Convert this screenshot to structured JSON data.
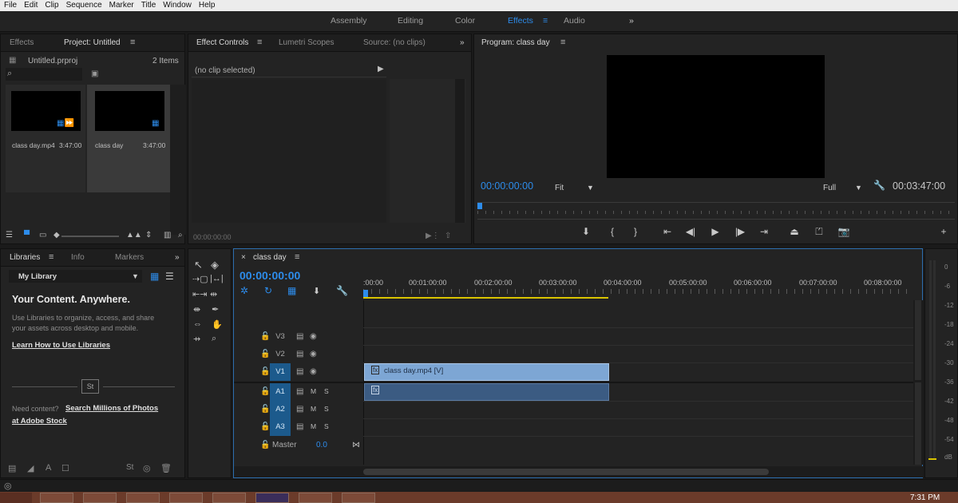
{
  "menu": [
    "File",
    "Edit",
    "Clip",
    "Sequence",
    "Marker",
    "Title",
    "Window",
    "Help"
  ],
  "workspaces": {
    "items": [
      "Assembly",
      "Editing",
      "Color",
      "Effects",
      "Audio"
    ],
    "active": "Effects",
    "more": "»"
  },
  "project_panel": {
    "tabs": [
      "Effects",
      "Project: Untitled"
    ],
    "file_name": "Untitled.prproj",
    "item_count": "2 Items",
    "items": [
      {
        "name": "class day.mp4",
        "duration": "3:47:00"
      },
      {
        "name": "class day",
        "duration": "3:47:00"
      }
    ]
  },
  "effect_controls": {
    "tabs": [
      "Effect Controls",
      "Lumetri Scopes",
      "Source: (no clips)"
    ],
    "no_clip": "(no clip selected)",
    "timecode": "00:00:00:00",
    "more": "»"
  },
  "program_monitor": {
    "title": "Program: class day",
    "timecode": "00:00:00:00",
    "fit": "Fit",
    "quality": "Full",
    "duration": "00:03:47:00"
  },
  "libraries_panel": {
    "tabs": [
      "Libraries",
      "Info",
      "Markers"
    ],
    "library": "My Library",
    "heading": "Your Content. Anywhere.",
    "desc_line1": "Use Libraries to organize, access, and share",
    "desc_line2": "your assets across desktop and mobile.",
    "learn_link": "Learn How to Use Libraries",
    "stock_badge": "St",
    "need_content": "Need content?",
    "search_link_1": "Search Millions of Photos",
    "search_link_2": "at Adobe Stock",
    "more": "»"
  },
  "timeline": {
    "sequence_name": "class day",
    "timecode": "00:00:00:00",
    "ruler": [
      ":00:00",
      "00:01:00:00",
      "00:02:00:00",
      "00:03:00:00",
      "00:04:00:00",
      "00:05:00:00",
      "00:06:00:00",
      "00:07:00:00",
      "00:08:00:00"
    ],
    "video_tracks": [
      "V3",
      "V2",
      "V1"
    ],
    "audio_tracks": [
      "A1",
      "A2",
      "A3"
    ],
    "mute": "M",
    "solo": "S",
    "master": {
      "label": "Master",
      "value": "0.0"
    },
    "clip_video": "class day.mp4 [V]",
    "clip_fx": "fx"
  },
  "meter": {
    "labels": [
      "0",
      "-6",
      "-12",
      "-18",
      "-24",
      "-30",
      "-36",
      "-42",
      "-48",
      "-54",
      "dB"
    ]
  },
  "taskbar": {
    "clock": "7:31 PM"
  }
}
